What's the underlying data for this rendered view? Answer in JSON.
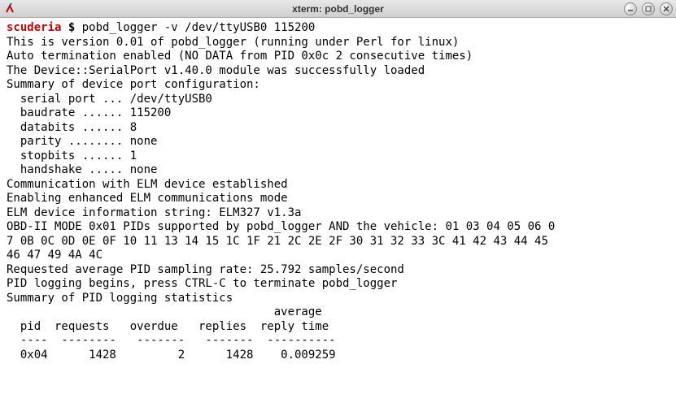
{
  "window": {
    "title": "xterm: pobd_logger"
  },
  "prompt": {
    "host": "scuderia",
    "separator": " $ ",
    "command": "pobd_logger -v /dev/ttyUSB0 115200"
  },
  "lines": {
    "version": "This is version 0.01 of pobd_logger (running under Perl for linux)",
    "autoterm": "Auto termination enabled (NO DATA from PID 0x0c 2 consecutive times)",
    "serialport": "The Device::SerialPort v1.40.0 module was successfully loaded",
    "summary_hdr": "Summary of device port configuration:",
    "cfg_serial": "  serial port ... /dev/ttyUSB0",
    "cfg_baud": "  baudrate ...... 115200",
    "cfg_databits": "  databits ...... 8",
    "cfg_parity": "  parity ........ none",
    "cfg_stopbits": "  stopbits ...... 1",
    "cfg_handshake": "  handshake ..... none",
    "comm_est": "Communication with ELM device established",
    "enh_mode": "Enabling enhanced ELM communications mode",
    "elm_info": "ELM device information string: ELM327 v1.3a",
    "pids1": "OBD-II MODE 0x01 PIDs supported by pobd_logger AND the vehicle: 01 03 04 05 06 0",
    "pids2": "7 0B 0C 0D 0E 0F 10 11 13 14 15 1C 1F 21 2C 2E 2F 30 31 32 33 3C 41 42 43 44 45 ",
    "pids3": "46 47 49 4A 4C",
    "rate": "Requested average PID sampling rate: 25.792 samples/second",
    "begin": "PID logging begins, press CTRL-C to terminate pobd_logger",
    "stats_hdr": "Summary of PID logging statistics",
    "tbl_h1": "                                       average",
    "tbl_h2": "  pid  requests   overdue   replies  reply time",
    "tbl_sep": "  ----  --------   -------   -------  ----------",
    "tbl_row": "  0x04      1428         2      1428    0.009259"
  },
  "stats_table": {
    "columns": [
      "pid",
      "requests",
      "overdue",
      "replies",
      "average reply time"
    ],
    "rows": [
      {
        "pid": "0x04",
        "requests": 1428,
        "overdue": 2,
        "replies": 1428,
        "avg_reply_time": 0.009259
      }
    ]
  }
}
